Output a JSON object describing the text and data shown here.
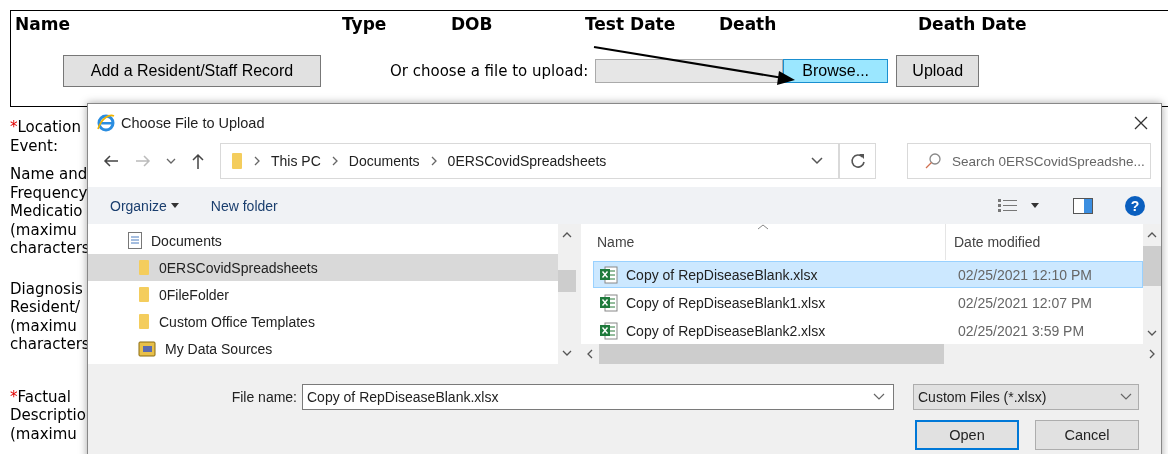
{
  "form": {
    "columns": [
      "Name",
      "Type",
      "DOB",
      "Test Date",
      "Death",
      "Death Date"
    ],
    "add_button": "Add a Resident/Staff Record",
    "upload_prompt": "Or choose a file to upload:",
    "browse_button": {
      "label": "Browse...",
      "focused": true
    },
    "upload_button": "Upload",
    "fields": [
      {
        "mark": "*",
        "lines": [
          "Location",
          "Event:"
        ]
      },
      {
        "lines": [
          "Name and",
          "Frequency",
          "Medicatio",
          "(maximu",
          "characters"
        ]
      },
      {
        "lines": [
          "Diagnosis",
          "Resident/",
          "(maximu",
          "characters"
        ]
      },
      {
        "mark": "*",
        "lines": [
          "Factual",
          "Descriptio",
          "(maximu"
        ]
      }
    ]
  },
  "dialog": {
    "title": "Choose File to Upload",
    "breadcrumb": [
      "This PC",
      "Documents",
      "0ERSCovidSpreadsheets"
    ],
    "search": {
      "placeholder": "Search 0ERSCovidSpreadshe..."
    },
    "toolbar": [
      "Organize",
      "New folder"
    ],
    "help_label": "?",
    "nav_items": [
      {
        "label": "Documents",
        "kind": "documents",
        "selected": false
      },
      {
        "label": "0ERSCovidSpreadsheets",
        "kind": "folder",
        "selected": true
      },
      {
        "label": "0FileFolder",
        "kind": "folder",
        "selected": false
      },
      {
        "label": "Custom Office Templates",
        "kind": "folder",
        "selected": false
      },
      {
        "label": "My Data Sources",
        "kind": "datasource",
        "selected": false
      }
    ],
    "columns": [
      "Name",
      "Date modified"
    ],
    "files": [
      {
        "name": "Copy of RepDiseaseBlank.xlsx",
        "date": "02/25/2021 12:10 PM",
        "selected": true
      },
      {
        "name": "Copy of RepDiseaseBlank1.xlsx",
        "date": "02/25/2021 12:07 PM",
        "selected": false
      },
      {
        "name": "Copy of RepDiseaseBlank2.xlsx",
        "date": "02/25/2021 3:59 PM",
        "selected": false
      }
    ],
    "file_name_label": "File name:",
    "file_name": "Copy of RepDiseaseBlank.xlsx",
    "filter": "Custom Files (*.xlsx)",
    "buttons": [
      "Open",
      "Cancel"
    ]
  }
}
